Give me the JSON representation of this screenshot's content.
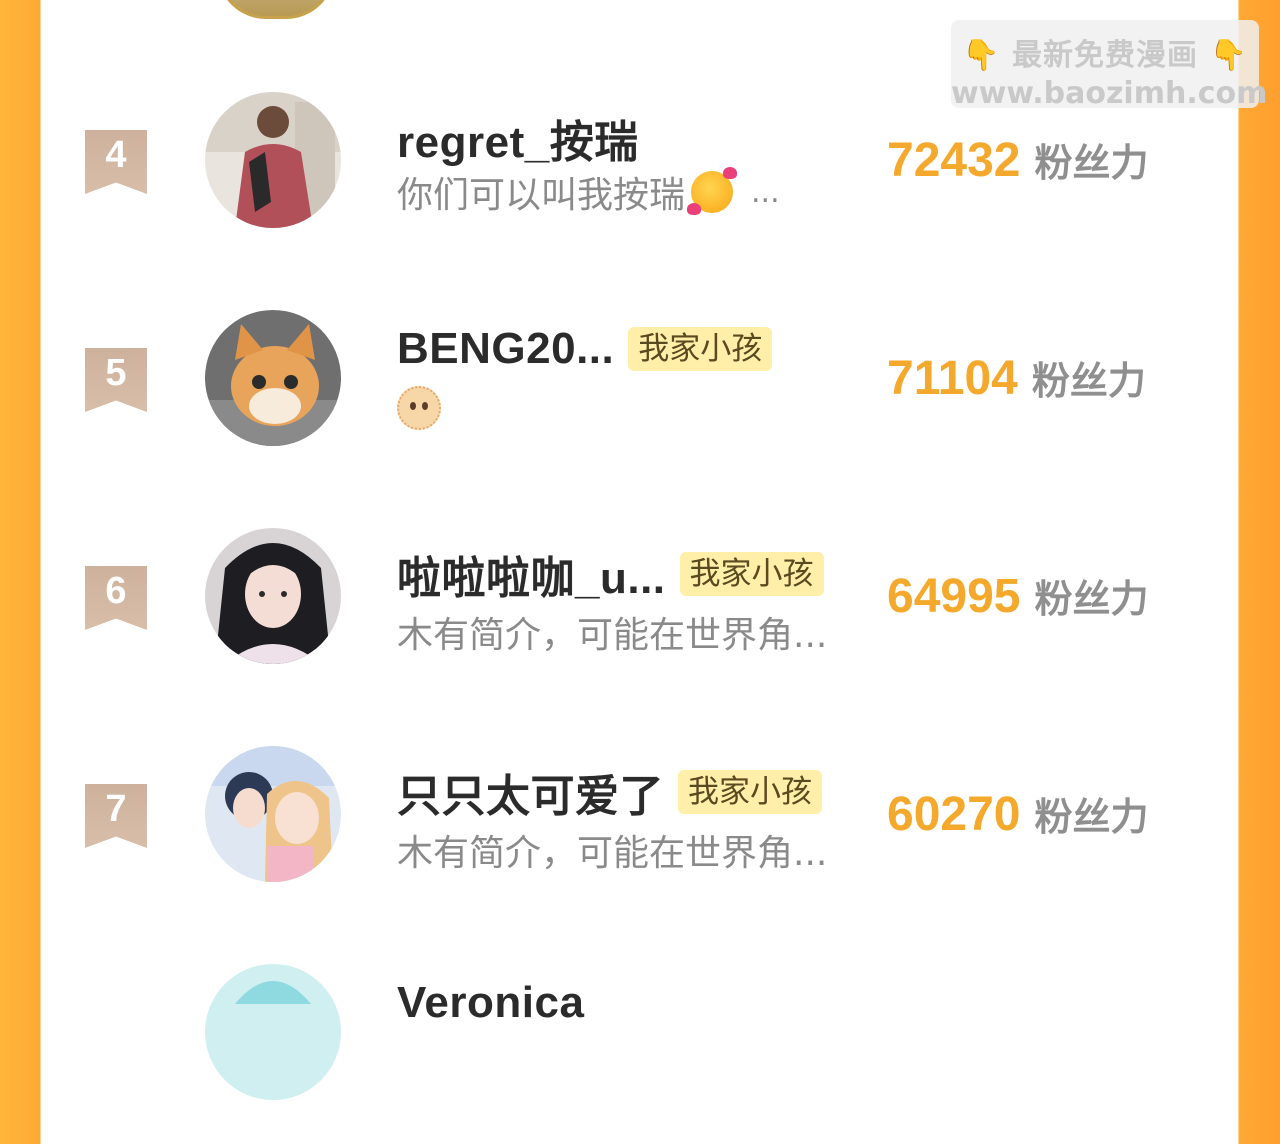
{
  "watermark": {
    "line1": "最新免费漫画",
    "hand_left": "👇",
    "hand_right": "👇",
    "line2": "www.baozimh.com"
  },
  "unit_label": "粉丝力",
  "rows": [
    {
      "rank": "4",
      "name": "regret_按瑞",
      "tag": "",
      "bio": "你们可以叫我按瑞",
      "bio_suffix": "...",
      "score": "72432",
      "unit": "粉丝力"
    },
    {
      "rank": "5",
      "name": "BENG20...",
      "tag": "我家小孩",
      "bio": "",
      "bio_suffix": "",
      "score": "71104",
      "unit": "粉丝力"
    },
    {
      "rank": "6",
      "name": "啦啦啦咖_u...",
      "tag": "我家小孩",
      "bio": "木有简介，可能在世界角...",
      "bio_suffix": "",
      "score": "64995",
      "unit": "粉丝力"
    },
    {
      "rank": "7",
      "name": "只只太可爱了",
      "tag": "我家小孩",
      "bio": "木有简介，可能在世界角...",
      "bio_suffix": "",
      "score": "60270",
      "unit": "粉丝力"
    },
    {
      "rank": "",
      "name": "Veronica",
      "tag": "",
      "bio": "",
      "bio_suffix": "",
      "score": "",
      "unit": ""
    }
  ]
}
